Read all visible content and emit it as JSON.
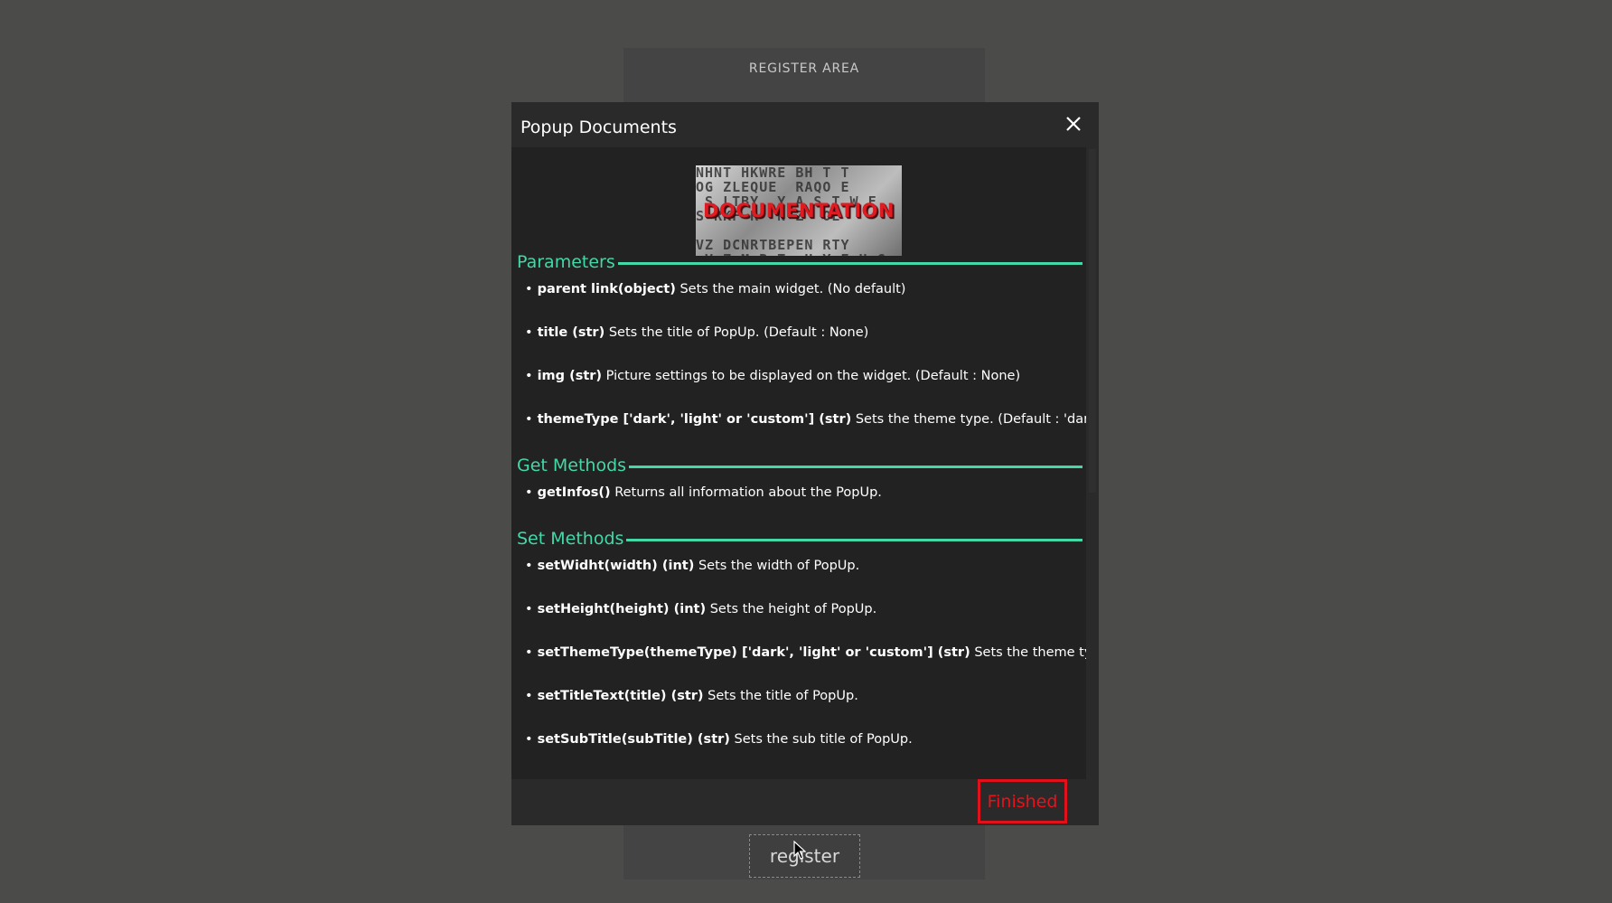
{
  "register_area": {
    "title": "REGISTER AREA",
    "button_label": "register"
  },
  "popup": {
    "title": "Popup Documents",
    "image_text": "DOCUMENTATION",
    "finished_label": "Finished",
    "sections": [
      {
        "heading": "Parameters",
        "items": [
          {
            "name": "parent link(object)",
            "desc": "Sets the main widget. (No default)"
          },
          {
            "name": "title (str)",
            "desc": "Sets the title of PopUp. (Default : None)"
          },
          {
            "name": "img (str)",
            "desc": "Picture settings to be displayed on the widget. (Default : None)"
          },
          {
            "name": "themeType ['dark', 'light' or 'custom'] (str)",
            "desc": "Sets the theme type. (Default : 'dark')"
          }
        ]
      },
      {
        "heading": "Get Methods",
        "items": [
          {
            "name": "getInfos()",
            "desc": "Returns all information about the PopUp."
          }
        ]
      },
      {
        "heading": "Set Methods",
        "items": [
          {
            "name": "setWidht(width) (int)",
            "desc": "Sets the width of PopUp."
          },
          {
            "name": "setHeight(height) (int)",
            "desc": "Sets the height of PopUp."
          },
          {
            "name": "setThemeType(themeType) ['dark', 'light' or 'custom'] (str)",
            "desc": "Sets the theme type."
          },
          {
            "name": "setTitleText(title) (str)",
            "desc": "Sets the title of PopUp."
          },
          {
            "name": "setSubTitle(subTitle) (str)",
            "desc": "Sets the sub title of PopUp."
          }
        ]
      }
    ]
  },
  "colors": {
    "background": "#4b4b4a",
    "panel": "#444444",
    "popup": "#2a2a2a",
    "popup_body": "#222222",
    "accent": "#44d7a8",
    "finished": "#e8121c"
  },
  "icons": {
    "close": "close-icon",
    "cursor": "cursor-icon"
  }
}
